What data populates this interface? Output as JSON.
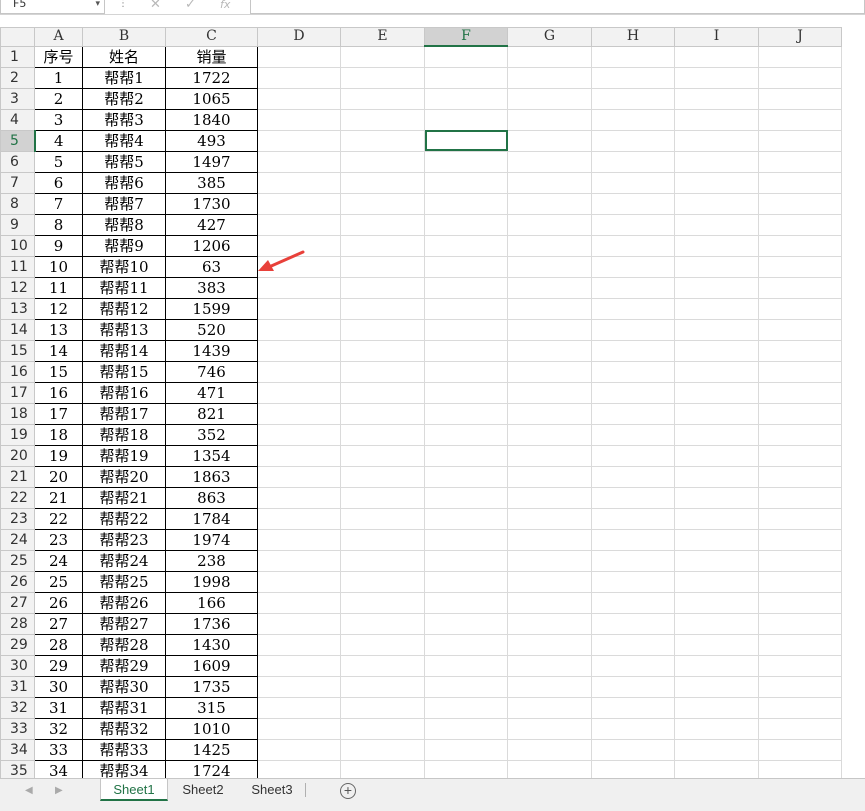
{
  "formula_bar": {
    "name_box": "F5",
    "name_box_icon": "chevron-down-icon",
    "cancel_icon": "close-icon",
    "enter_icon": "check-icon",
    "function_icon": "fx-icon",
    "fx_label": "fx",
    "formula": ""
  },
  "columns": [
    "A",
    "B",
    "C",
    "D",
    "E",
    "F",
    "G",
    "H",
    "I",
    "J"
  ],
  "selected_cell": "F5",
  "rows": [
    {
      "n": "1",
      "a": "序号",
      "b": "姓名",
      "c": "销量"
    },
    {
      "n": "2",
      "a": "1",
      "b": "帮帮1",
      "c": "1722"
    },
    {
      "n": "3",
      "a": "2",
      "b": "帮帮2",
      "c": "1065"
    },
    {
      "n": "4",
      "a": "3",
      "b": "帮帮3",
      "c": "1840"
    },
    {
      "n": "5",
      "a": "4",
      "b": "帮帮4",
      "c": "493"
    },
    {
      "n": "6",
      "a": "5",
      "b": "帮帮5",
      "c": "1497"
    },
    {
      "n": "7",
      "a": "6",
      "b": "帮帮6",
      "c": "385"
    },
    {
      "n": "8",
      "a": "7",
      "b": "帮帮7",
      "c": "1730"
    },
    {
      "n": "9",
      "a": "8",
      "b": "帮帮8",
      "c": "427"
    },
    {
      "n": "10",
      "a": "9",
      "b": "帮帮9",
      "c": "1206"
    },
    {
      "n": "11",
      "a": "10",
      "b": "帮帮10",
      "c": "63"
    },
    {
      "n": "12",
      "a": "11",
      "b": "帮帮11",
      "c": "383"
    },
    {
      "n": "13",
      "a": "12",
      "b": "帮帮12",
      "c": "1599"
    },
    {
      "n": "14",
      "a": "13",
      "b": "帮帮13",
      "c": "520"
    },
    {
      "n": "15",
      "a": "14",
      "b": "帮帮14",
      "c": "1439"
    },
    {
      "n": "16",
      "a": "15",
      "b": "帮帮15",
      "c": "746"
    },
    {
      "n": "17",
      "a": "16",
      "b": "帮帮16",
      "c": "471"
    },
    {
      "n": "18",
      "a": "17",
      "b": "帮帮17",
      "c": "821"
    },
    {
      "n": "19",
      "a": "18",
      "b": "帮帮18",
      "c": "352"
    },
    {
      "n": "20",
      "a": "19",
      "b": "帮帮19",
      "c": "1354"
    },
    {
      "n": "21",
      "a": "20",
      "b": "帮帮20",
      "c": "1863"
    },
    {
      "n": "22",
      "a": "21",
      "b": "帮帮21",
      "c": "863"
    },
    {
      "n": "23",
      "a": "22",
      "b": "帮帮22",
      "c": "1784"
    },
    {
      "n": "24",
      "a": "23",
      "b": "帮帮23",
      "c": "1974"
    },
    {
      "n": "25",
      "a": "24",
      "b": "帮帮24",
      "c": "238"
    },
    {
      "n": "26",
      "a": "25",
      "b": "帮帮25",
      "c": "1998"
    },
    {
      "n": "27",
      "a": "26",
      "b": "帮帮26",
      "c": "166"
    },
    {
      "n": "28",
      "a": "27",
      "b": "帮帮27",
      "c": "1736"
    },
    {
      "n": "29",
      "a": "28",
      "b": "帮帮28",
      "c": "1430"
    },
    {
      "n": "30",
      "a": "29",
      "b": "帮帮29",
      "c": "1609"
    },
    {
      "n": "31",
      "a": "30",
      "b": "帮帮30",
      "c": "1735"
    },
    {
      "n": "32",
      "a": "31",
      "b": "帮帮31",
      "c": "315"
    },
    {
      "n": "33",
      "a": "32",
      "b": "帮帮32",
      "c": "1010"
    },
    {
      "n": "34",
      "a": "33",
      "b": "帮帮33",
      "c": "1425"
    },
    {
      "n": "35",
      "a": "34",
      "b": "帮帮34",
      "c": "1724"
    }
  ],
  "annotation": {
    "icon": "red-arrow-icon",
    "color": "#e8403a"
  },
  "sheet_tabs": [
    {
      "label": "Sheet1",
      "active": true
    },
    {
      "label": "Sheet2",
      "active": false
    },
    {
      "label": "Sheet3",
      "active": false
    }
  ],
  "add_sheet_label": "⊕",
  "colors": {
    "accent": "#217346",
    "arrow": "#e8403a"
  }
}
